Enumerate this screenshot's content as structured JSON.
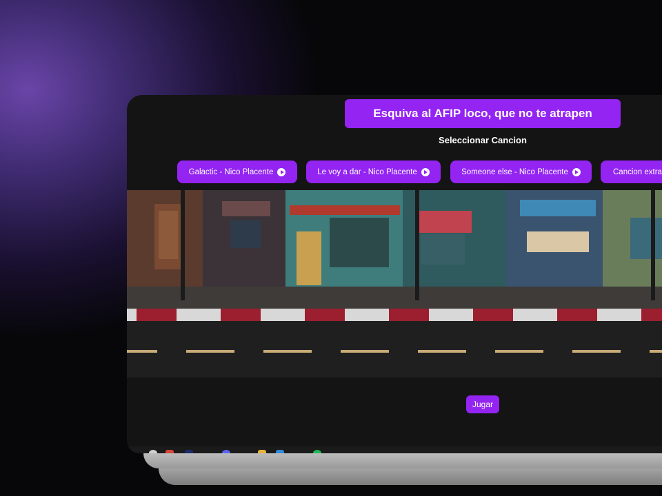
{
  "header": {
    "title": "Esquiva al AFIP loco, que no te atrapen",
    "select_label": "Seleccionar Cancion"
  },
  "songs": [
    {
      "label": "Galactic - Nico Placente"
    },
    {
      "label": "Le voy a dar - Nico Placente"
    },
    {
      "label": "Someone else - Nico Placente"
    },
    {
      "label": "Cancion extra"
    }
  ],
  "play_button": {
    "label": "Jugar"
  },
  "colors": {
    "accent": "#9424f2",
    "window_bg": "#141414",
    "page_bg": "#07070a",
    "glow": "#6a45a8"
  },
  "icons": [
    "play-circle-icon",
    "search-icon",
    "chrome-icon",
    "photoshop-icon",
    "discord-icon",
    "folder-icon",
    "vscode-icon",
    "spotify-icon"
  ]
}
